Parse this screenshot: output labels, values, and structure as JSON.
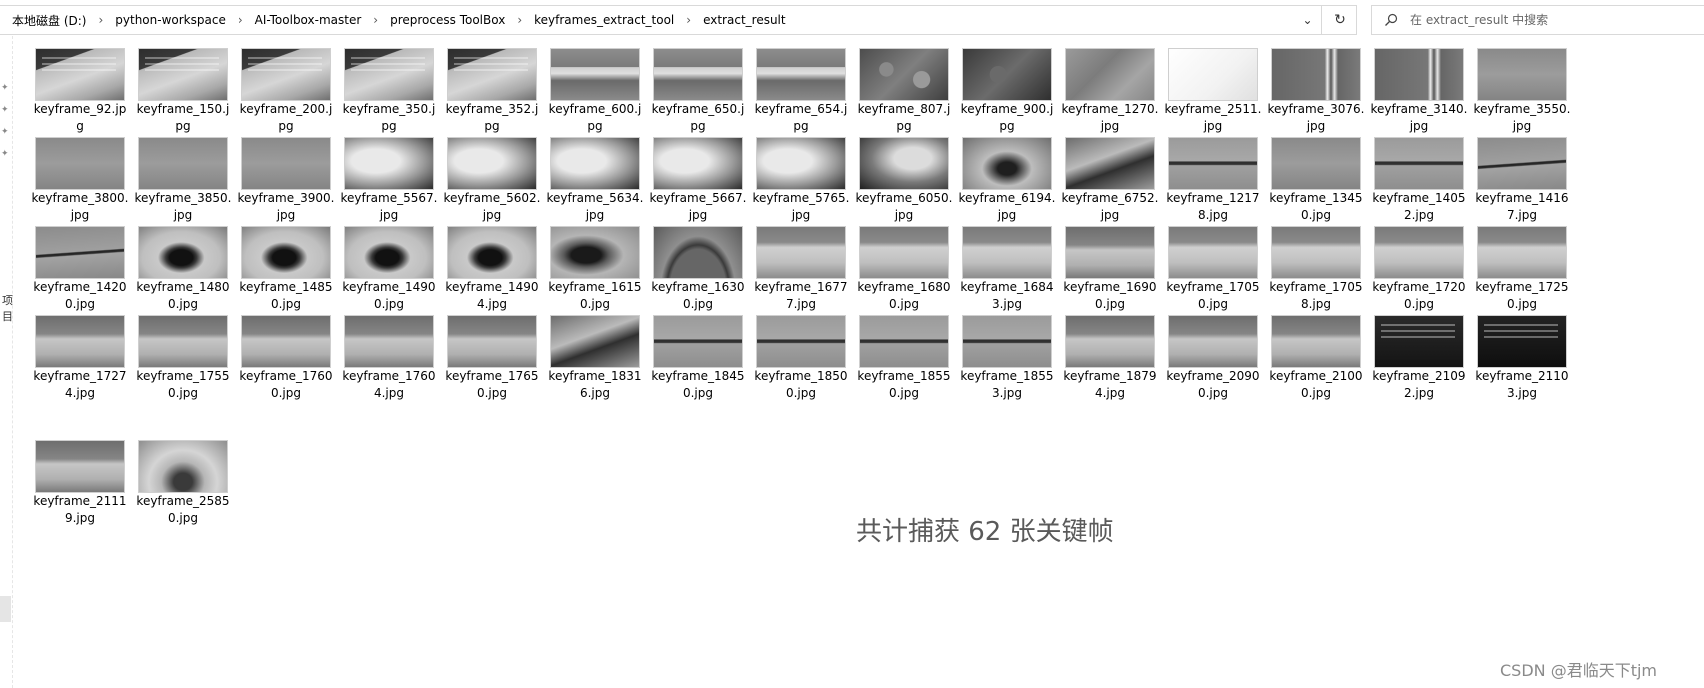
{
  "address_bar": {
    "breadcrumb": [
      "本地磁盘 (D:)",
      "python-workspace",
      "AI-Toolbox-master",
      "preprocess ToolBox",
      "keyframes_extract_tool",
      "extract_result"
    ],
    "separator": "›",
    "dropdown_icon": "chevron-down-icon",
    "refresh_icon": "refresh-icon"
  },
  "search": {
    "placeholder": "在 extract_result 中搜索",
    "value": "",
    "icon": "search-icon"
  },
  "nav": {
    "partial_label": "项目",
    "pin_icon": "pin-icon"
  },
  "files": [
    {
      "name": "keyframe_92.jpg",
      "label_line1": "keyframe_92.jp",
      "label_line2": "g",
      "style": "stone"
    },
    {
      "name": "keyframe_150.jpg",
      "label_line1": "keyframe_150.j",
      "label_line2": "pg",
      "style": "stone"
    },
    {
      "name": "keyframe_200.jpg",
      "label_line1": "keyframe_200.j",
      "label_line2": "pg",
      "style": "stone"
    },
    {
      "name": "keyframe_350.jpg",
      "label_line1": "keyframe_350.j",
      "label_line2": "pg",
      "style": "stone"
    },
    {
      "name": "keyframe_352.jpg",
      "label_line1": "keyframe_352.j",
      "label_line2": "pg",
      "style": "stone"
    },
    {
      "name": "keyframe_600.jpg",
      "label_line1": "keyframe_600.j",
      "label_line2": "pg",
      "style": "curb"
    },
    {
      "name": "keyframe_650.jpg",
      "label_line1": "keyframe_650.j",
      "label_line2": "pg",
      "style": "curb"
    },
    {
      "name": "keyframe_654.jpg",
      "label_line1": "keyframe_654.j",
      "label_line2": "pg",
      "style": "curb"
    },
    {
      "name": "keyframe_807.jpg",
      "label_line1": "keyframe_807.j",
      "label_line2": "pg",
      "style": "leaf"
    },
    {
      "name": "keyframe_900.jpg",
      "label_line1": "keyframe_900.j",
      "label_line2": "pg",
      "style": "leafdk"
    },
    {
      "name": "keyframe_1270.jpg",
      "label_line1": "keyframe_1270.",
      "label_line2": "jpg",
      "style": "gravel"
    },
    {
      "name": "keyframe_2511.jpg",
      "label_line1": "keyframe_2511.",
      "label_line2": "jpg",
      "style": "white"
    },
    {
      "name": "keyframe_3076.jpg",
      "label_line1": "keyframe_3076.",
      "label_line2": "jpg",
      "style": "pole"
    },
    {
      "name": "keyframe_3140.jpg",
      "label_line1": "keyframe_3140.",
      "label_line2": "jpg",
      "style": "pole"
    },
    {
      "name": "keyframe_3550.jpg",
      "label_line1": "keyframe_3550.",
      "label_line2": "jpg",
      "style": "grey"
    },
    {
      "name": "keyframe_3800.jpg",
      "label_line1": "keyframe_3800.",
      "label_line2": "jpg",
      "style": "grey"
    },
    {
      "name": "keyframe_3850.jpg",
      "label_line1": "keyframe_3850.",
      "label_line2": "jpg",
      "style": "grey"
    },
    {
      "name": "keyframe_3900.jpg",
      "label_line1": "keyframe_3900.",
      "label_line2": "jpg",
      "style": "grey"
    },
    {
      "name": "keyframe_5567.jpg",
      "label_line1": "keyframe_5567.",
      "label_line2": "jpg",
      "style": "fade"
    },
    {
      "name": "keyframe_5602.jpg",
      "label_line1": "keyframe_5602.",
      "label_line2": "jpg",
      "style": "fade"
    },
    {
      "name": "keyframe_5634.jpg",
      "label_line1": "keyframe_5634.",
      "label_line2": "jpg",
      "style": "fade"
    },
    {
      "name": "keyframe_5667.jpg",
      "label_line1": "keyframe_5667.",
      "label_line2": "jpg",
      "style": "fade"
    },
    {
      "name": "keyframe_5765.jpg",
      "label_line1": "keyframe_5765.",
      "label_line2": "jpg",
      "style": "fade"
    },
    {
      "name": "keyframe_6050.jpg",
      "label_line1": "keyframe_6050.",
      "label_line2": "jpg",
      "style": "fade2"
    },
    {
      "name": "keyframe_6194.jpg",
      "label_line1": "keyframe_6194.",
      "label_line2": "jpg",
      "style": "blur"
    },
    {
      "name": "keyframe_6752.jpg",
      "label_line1": "keyframe_6752.",
      "label_line2": "jpg",
      "style": "mixed"
    },
    {
      "name": "keyframe_12178.jpg",
      "label_line1": "keyframe_1217",
      "label_line2": "8.jpg",
      "style": "crack"
    },
    {
      "name": "keyframe_13450.jpg",
      "label_line1": "keyframe_1345",
      "label_line2": "0.jpg",
      "style": "grey"
    },
    {
      "name": "keyframe_14052.jpg",
      "label_line1": "keyframe_1405",
      "label_line2": "2.jpg",
      "style": "crack"
    },
    {
      "name": "keyframe_14167.jpg",
      "label_line1": "keyframe_1416",
      "label_line2": "7.jpg",
      "style": "crack2"
    },
    {
      "name": "keyframe_14200.jpg",
      "label_line1": "keyframe_1420",
      "label_line2": "0.jpg",
      "style": "crack2"
    },
    {
      "name": "keyframe_14800.jpg",
      "label_line1": "keyframe_1480",
      "label_line2": "0.jpg",
      "style": "pipe"
    },
    {
      "name": "keyframe_14850.jpg",
      "label_line1": "keyframe_1485",
      "label_line2": "0.jpg",
      "style": "pipe"
    },
    {
      "name": "keyframe_14900.jpg",
      "label_line1": "keyframe_1490",
      "label_line2": "0.jpg",
      "style": "pipe"
    },
    {
      "name": "keyframe_14904.jpg",
      "label_line1": "keyframe_1490",
      "label_line2": "4.jpg",
      "style": "pipe"
    },
    {
      "name": "keyframe_16150.jpg",
      "label_line1": "keyframe_1615",
      "label_line2": "0.jpg",
      "style": "pipe2"
    },
    {
      "name": "keyframe_16300.jpg",
      "label_line1": "keyframe_1630",
      "label_line2": "0.jpg",
      "style": "arch"
    },
    {
      "name": "keyframe_16777.jpg",
      "label_line1": "keyframe_1677",
      "label_line2": "7.jpg",
      "style": "pave"
    },
    {
      "name": "keyframe_16800.jpg",
      "label_line1": "keyframe_1680",
      "label_line2": "0.jpg",
      "style": "pave"
    },
    {
      "name": "keyframe_16843.jpg",
      "label_line1": "keyframe_1684",
      "label_line2": "3.jpg",
      "style": "pave"
    },
    {
      "name": "keyframe_16900.jpg",
      "label_line1": "keyframe_1690",
      "label_line2": "0.jpg",
      "style": "pave2"
    },
    {
      "name": "keyframe_17050.jpg",
      "label_line1": "keyframe_1705",
      "label_line2": "0.jpg",
      "style": "pave"
    },
    {
      "name": "keyframe_17058.jpg",
      "label_line1": "keyframe_1705",
      "label_line2": "8.jpg",
      "style": "pave"
    },
    {
      "name": "keyframe_17200.jpg",
      "label_line1": "keyframe_1720",
      "label_line2": "0.jpg",
      "style": "pave"
    },
    {
      "name": "keyframe_17250.jpg",
      "label_line1": "keyframe_1725",
      "label_line2": "0.jpg",
      "style": "pave"
    },
    {
      "name": "keyframe_17274.jpg",
      "label_line1": "keyframe_1727",
      "label_line2": "4.jpg",
      "style": "pave2"
    },
    {
      "name": "keyframe_17550.jpg",
      "label_line1": "keyframe_1755",
      "label_line2": "0.jpg",
      "style": "pave2"
    },
    {
      "name": "keyframe_17600.jpg",
      "label_line1": "keyframe_1760",
      "label_line2": "0.jpg",
      "style": "pave2"
    },
    {
      "name": "keyframe_17604.jpg",
      "label_line1": "keyframe_1760",
      "label_line2": "4.jpg",
      "style": "pave2"
    },
    {
      "name": "keyframe_17650.jpg",
      "label_line1": "keyframe_1765",
      "label_line2": "0.jpg",
      "style": "pave2"
    },
    {
      "name": "keyframe_18316.jpg",
      "label_line1": "keyframe_1831",
      "label_line2": "6.jpg",
      "style": "mixed"
    },
    {
      "name": "keyframe_18450.jpg",
      "label_line1": "keyframe_1845",
      "label_line2": "0.jpg",
      "style": "crack"
    },
    {
      "name": "keyframe_18500.jpg",
      "label_line1": "keyframe_1850",
      "label_line2": "0.jpg",
      "style": "crack"
    },
    {
      "name": "keyframe_18550.jpg",
      "label_line1": "keyframe_1855",
      "label_line2": "0.jpg",
      "style": "crack"
    },
    {
      "name": "keyframe_18553.jpg",
      "label_line1": "keyframe_1855",
      "label_line2": "3.jpg",
      "style": "crack"
    },
    {
      "name": "keyframe_18794.jpg",
      "label_line1": "keyframe_1879",
      "label_line2": "4.jpg",
      "style": "pave2"
    },
    {
      "name": "keyframe_20900.jpg",
      "label_line1": "keyframe_2090",
      "label_line2": "0.jpg",
      "style": "pave2"
    },
    {
      "name": "keyframe_21000.jpg",
      "label_line1": "keyframe_2100",
      "label_line2": "0.jpg",
      "style": "pave2"
    },
    {
      "name": "keyframe_21092.jpg",
      "label_line1": "keyframe_2109",
      "label_line2": "2.jpg",
      "style": "dark"
    },
    {
      "name": "keyframe_21103.jpg",
      "label_line1": "keyframe_2110",
      "label_line2": "3.jpg",
      "style": "dark2"
    },
    {
      "name": "keyframe_21119.jpg",
      "label_line1": "keyframe_2111",
      "label_line2": "9.jpg",
      "style": "pave2"
    },
    {
      "name": "keyframe_25850.jpg",
      "label_line1": "keyframe_2585",
      "label_line2": "0.jpg",
      "style": "arch2"
    }
  ],
  "caption": "共计捕获 62 张关键帧",
  "watermark": "CSDN @君临天下tjm"
}
